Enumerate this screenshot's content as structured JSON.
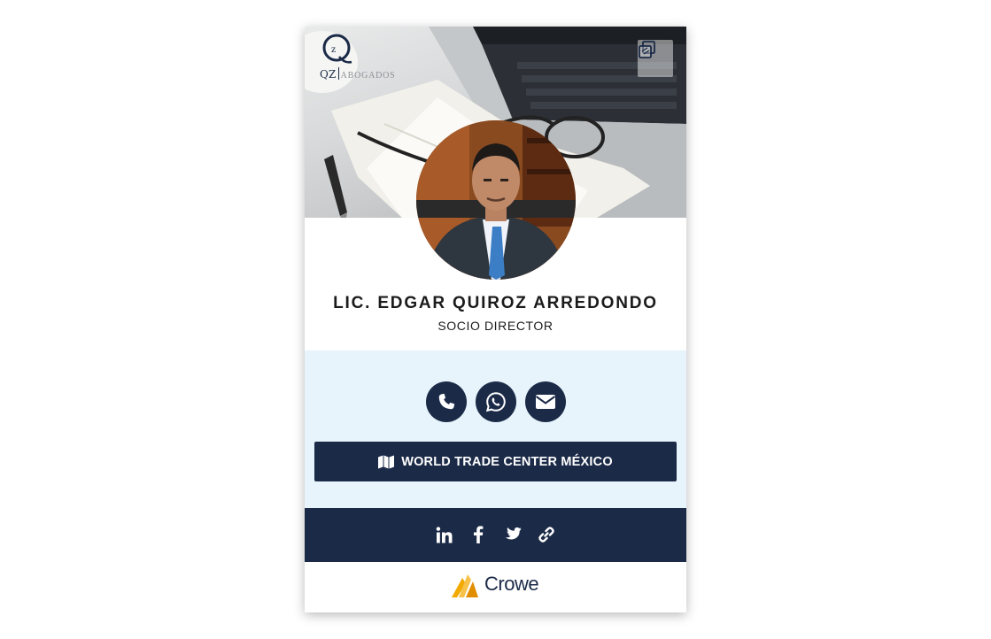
{
  "brand": {
    "logo_letters": "QZ",
    "logo_firm": "ABOGADOS",
    "primary_color": "#1b2a47",
    "contact_bg_color": "#e7f4fc"
  },
  "header": {
    "copy_icon": "copy-icon"
  },
  "profile": {
    "name": "LIC. EDGAR QUIROZ ARREDONDO",
    "role": "SOCIO DIRECTOR"
  },
  "contact": {
    "buttons": [
      {
        "icon": "phone-icon"
      },
      {
        "icon": "whatsapp-icon"
      },
      {
        "icon": "envelope-icon"
      }
    ],
    "location_icon": "map-icon",
    "location_label": "WORLD TRADE CENTER MÉXICO"
  },
  "social": {
    "links": [
      {
        "icon": "linkedin-icon"
      },
      {
        "icon": "facebook-icon"
      },
      {
        "icon": "twitter-icon"
      },
      {
        "icon": "link-icon"
      }
    ]
  },
  "footer": {
    "partner_name": "Crowe",
    "partner_color": "#f2a900"
  }
}
